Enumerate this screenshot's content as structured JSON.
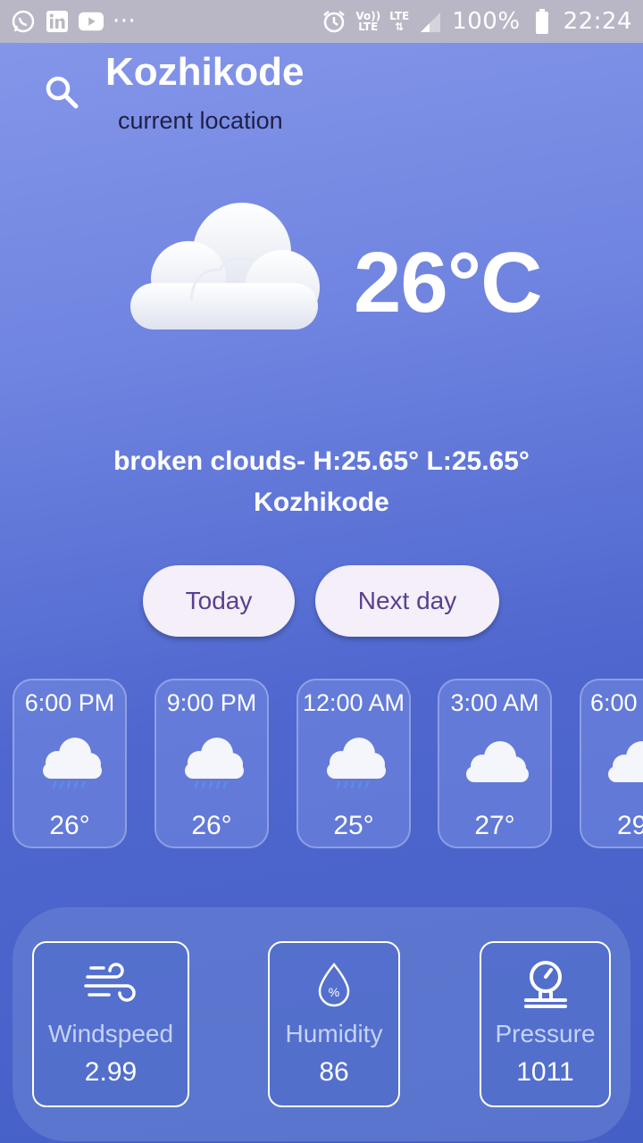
{
  "status_bar": {
    "battery": "100%",
    "time": "22:24",
    "overflow": "···",
    "volte_line1": "Vo))",
    "volte_line2": "LTE",
    "lte_label": "LTE"
  },
  "header": {
    "city": "Kozhikode",
    "subtitle": "current location"
  },
  "current": {
    "temperature": "26°C",
    "description": "broken clouds- H:25.65° L:25.65°",
    "city_line": "Kozhikode",
    "icon": "cloud-icon"
  },
  "buttons": {
    "today": "Today",
    "next_day": "Next day"
  },
  "hourly": [
    {
      "time": "6:00 PM",
      "temp": "26°",
      "icon": "rain-cloud-icon"
    },
    {
      "time": "9:00 PM",
      "temp": "26°",
      "icon": "rain-cloud-icon"
    },
    {
      "time": "12:00 AM",
      "temp": "25°",
      "icon": "rain-cloud-icon"
    },
    {
      "time": "3:00 AM",
      "temp": "27°",
      "icon": "cloud-icon"
    },
    {
      "time": "6:00",
      "temp": "29",
      "icon": "cloud-icon"
    }
  ],
  "details": {
    "windspeed": {
      "label": "Windspeed",
      "value": "2.99",
      "icon": "wind-icon"
    },
    "humidity": {
      "label": "Humidity",
      "value": "86",
      "icon": "humidity-drop-icon",
      "symbol": "%"
    },
    "pressure": {
      "label": "Pressure",
      "value": "1011",
      "icon": "pressure-gauge-icon"
    }
  },
  "colors": {
    "pill_bg": "#f4eff8",
    "pill_text": "#5b3f8f",
    "status_bar": "#b9b7c6"
  }
}
